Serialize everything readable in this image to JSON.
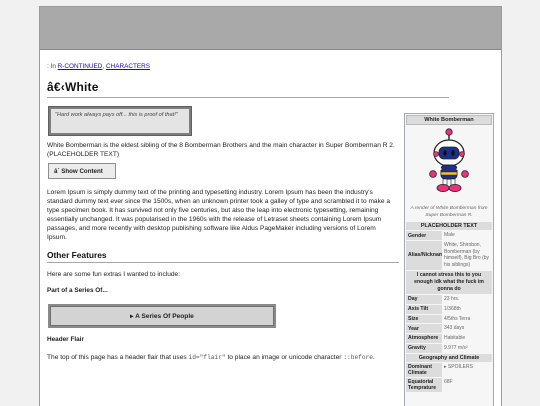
{
  "breadcrumb": {
    "prefix": ": In",
    "category_1": "R-CONTINUED",
    "separator": ",",
    "category_2": "CHARACTERS"
  },
  "page": {
    "title": "â€‹White"
  },
  "quote": {
    "text": "\"Hard work always pays off... this is proof of that!\""
  },
  "intro": {
    "text": "White Bomberman is the eldest sibling of the 8 Bomberman Brothers and the main character in Super Bomberman R 2. (PLACEHOLDER TEXT)"
  },
  "show_button": {
    "icon": "â´",
    "label": "Show Content"
  },
  "lorem": {
    "text": "Lorem Ipsum is simply dummy text of the printing and typesetting industry. Lorem Ipsum has been the industry's standard dummy text ever since the 1500s, when an unknown printer took a galley of type and scrambled it to make a type specimen book. It has survived not only five centuries, but also the leap into electronic typesetting, remaining essentially unchanged. It was popularised in the 1960s with the release of Letraset sheets containing Lorem Ipsum passages, and more recently with desktop publishing software like Aldus PageMaker including versions of Lorem Ipsum."
  },
  "other_features": {
    "heading": "Other Features",
    "intro": "Here are some fun extras I wanted to include:",
    "series_heading": "Part of a Series Of...",
    "series_button_icon": "▸",
    "series_button": "A Series Of People",
    "flair_heading": "Header Flair",
    "flair_text_before": "The top of this page has a header flair that uses ",
    "flair_code_1": "id=\"flair\"",
    "flair_text_middle": " to place an image or unicode character ",
    "flair_code_2": "::before",
    "flair_text_after": "."
  },
  "infobox": {
    "title": "White Bomberman",
    "caption": "A render of White Bomberman from Super Bomberman R.",
    "section_placeholder": "PLACEHOLDER TEXT",
    "rows_top": [
      {
        "key": "Gender",
        "value": "Male"
      },
      {
        "key": "Alias/Nicknames",
        "value": "White, Shirobon, Bomberman (by himself), Big Bro (by his siblings)"
      }
    ],
    "note": "I cannot stress this to you enough idk what the fuck im gonna do",
    "rows_mid": [
      {
        "key": "Day",
        "value": "23 hrs."
      },
      {
        "key": "Axis Tilt",
        "value": "1/368th"
      },
      {
        "key": "Size",
        "value": "4/5ths Terra"
      },
      {
        "key": "Year",
        "value": "343 days"
      },
      {
        "key": "Atmosphere",
        "value": "Habitable"
      },
      {
        "key": "Gravity",
        "value": "9.977 m/s²"
      }
    ],
    "section_geo": "Geography and Climate",
    "rows_geo": [
      {
        "key": "Dominant Climate",
        "value": "▸ SPOILERS"
      },
      {
        "key": "Equatorial Temprature",
        "value": "68F"
      }
    ]
  },
  "colors": {
    "banner": "#a9a9a9",
    "link": "#1a0dab",
    "infobox_header": "#dcdcdc",
    "bomberman_helmet": "#ffffff",
    "bomberman_accent": "#e8327c",
    "bomberman_visor": "#1d2f8a"
  }
}
